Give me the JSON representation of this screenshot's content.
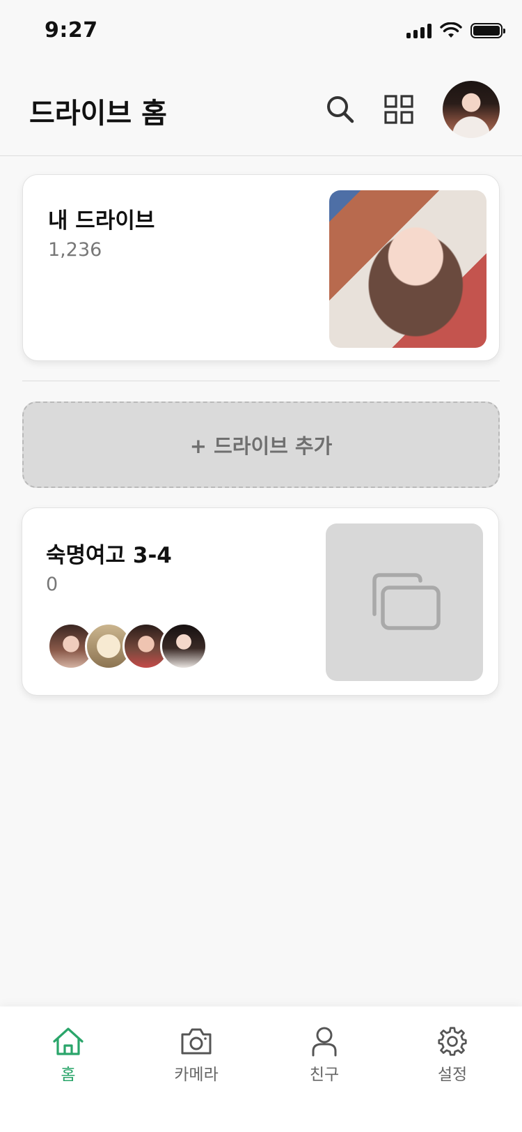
{
  "status_bar": {
    "time": "9:27"
  },
  "header": {
    "title": "드라이브 홈"
  },
  "my_drive": {
    "title": "내 드라이브",
    "count": "1,236"
  },
  "add_drive": {
    "label": "+ 드라이브 추가"
  },
  "shared_drive": {
    "title": "숙명여고 3-4",
    "count": "0",
    "member_count": 4
  },
  "bottom_nav": {
    "items": [
      {
        "label": "홈",
        "icon": "home-icon",
        "active": true
      },
      {
        "label": "카메라",
        "icon": "camera-icon",
        "active": false
      },
      {
        "label": "친구",
        "icon": "person-icon",
        "active": false
      },
      {
        "label": "설정",
        "icon": "gear-icon",
        "active": false
      }
    ]
  },
  "colors": {
    "accent": "#2aa56a",
    "background": "#f8f8f8",
    "card": "#ffffff",
    "placeholder": "#d8d8d8"
  }
}
